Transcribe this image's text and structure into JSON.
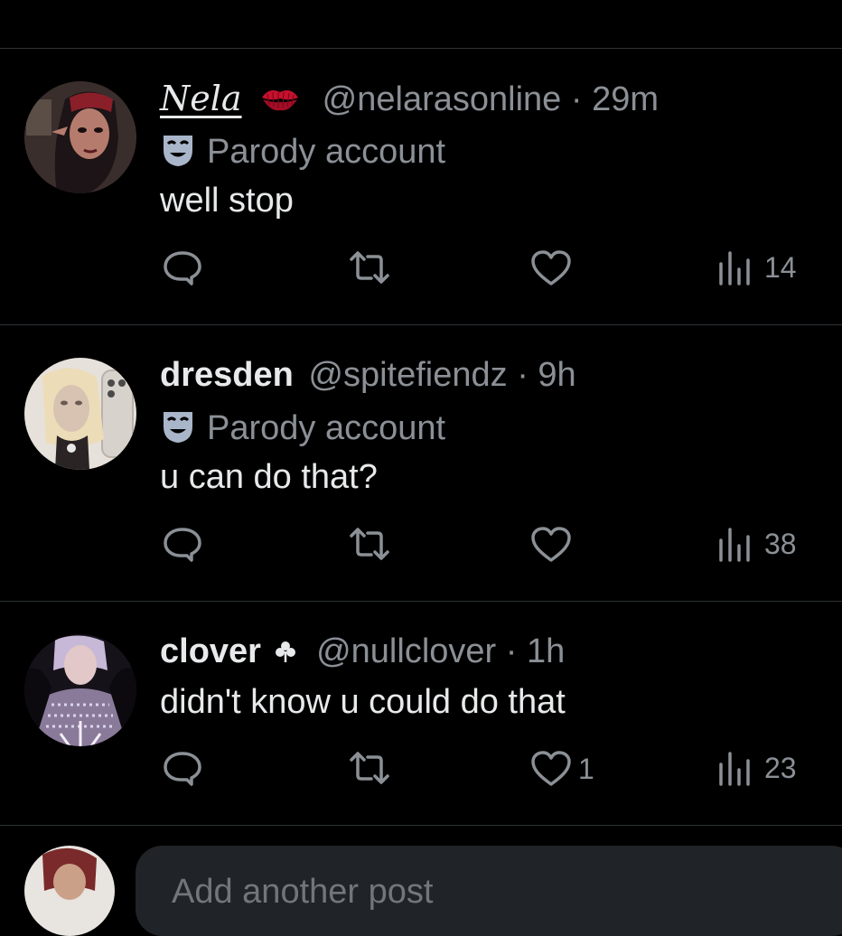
{
  "posts": [
    {
      "display_name": "Nela",
      "name_emoji": "kiss-mark-icon",
      "handle": "@nelarasonline",
      "separator": "·",
      "time": "29m",
      "parody_label": "Parody account",
      "text": "well stop",
      "likes": "",
      "views": "14",
      "avatar_colors": [
        "#3a2a2a",
        "#8c4a4a",
        "#c9a08a"
      ]
    },
    {
      "display_name": "dresden",
      "handle": "@spitefiendz",
      "separator": "·",
      "time": "9h",
      "parody_label": "Parody account",
      "text": "u can do that?",
      "likes": "",
      "views": "38",
      "avatar_colors": [
        "#e8e2da",
        "#c9b38a",
        "#6a5a4a"
      ]
    },
    {
      "display_name": "clover",
      "name_emoji": "clover-icon",
      "handle": "@nullclover",
      "separator": "·",
      "time": "1h",
      "text": "didn't know u could do that",
      "likes": "1",
      "views": "23",
      "avatar_colors": [
        "#1a1420",
        "#b9a3c9",
        "#6e5a8a"
      ]
    }
  ],
  "compose": {
    "placeholder": "Add another post"
  },
  "colors": {
    "background": "#000000",
    "primary_text": "#e7e9ea",
    "secondary_text": "#8b9096",
    "divider": "#2f3336",
    "lips": "#c8102e",
    "mask_badge": "#a9b6c9"
  }
}
